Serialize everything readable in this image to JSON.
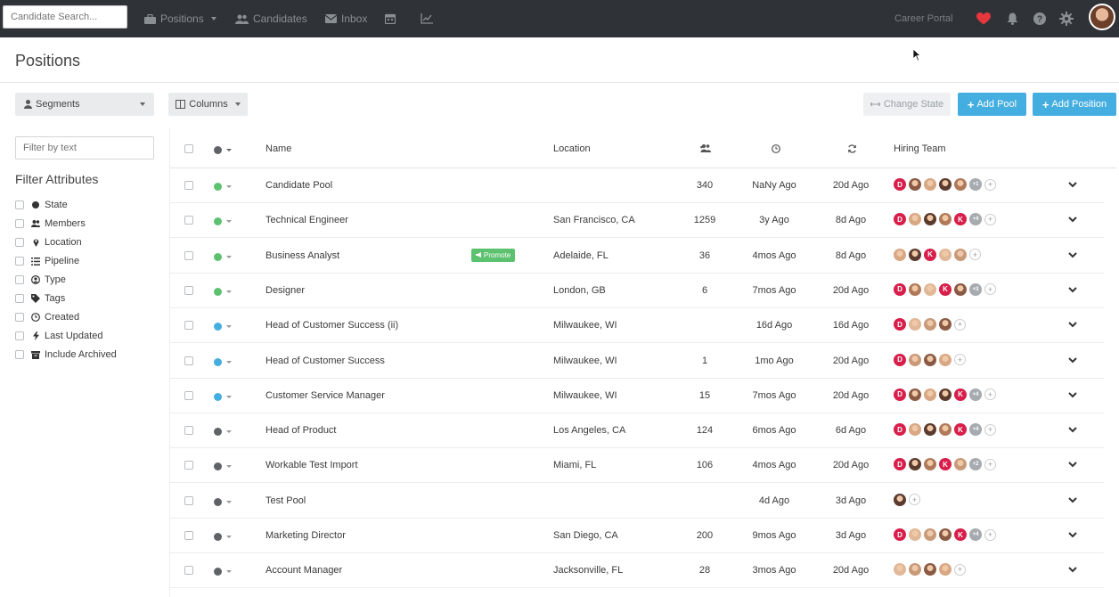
{
  "topbar": {
    "search_placeholder": "Candidate Search...",
    "nav": [
      {
        "label": "Positions",
        "icon": "briefcase-icon"
      },
      {
        "label": "Candidates",
        "icon": "users-icon"
      },
      {
        "label": "Inbox",
        "icon": "envelope-icon"
      },
      {
        "label": "",
        "icon": "calendar-icon"
      },
      {
        "label": "",
        "icon": "chart-icon"
      }
    ],
    "career_portal": "Career Portal"
  },
  "page": {
    "title": "Positions"
  },
  "toolbar": {
    "segments": "Segments",
    "columns": "Columns",
    "change_state": "Change State",
    "add_pool": "Add Pool",
    "add_position": "Add Position"
  },
  "sidebar": {
    "filter_placeholder": "Filter by text",
    "filter_title": "Filter Attributes",
    "attributes": [
      {
        "label": "State",
        "icon": "circle-icon"
      },
      {
        "label": "Members",
        "icon": "users-icon"
      },
      {
        "label": "Location",
        "icon": "map-pin-icon"
      },
      {
        "label": "Pipeline",
        "icon": "list-icon"
      },
      {
        "label": "Type",
        "icon": "user-circle-icon"
      },
      {
        "label": "Tags",
        "icon": "tag-icon"
      },
      {
        "label": "Created",
        "icon": "clock-icon"
      },
      {
        "label": "Last Updated",
        "icon": "bolt-icon"
      },
      {
        "label": "Include Archived",
        "icon": "archive-icon"
      }
    ]
  },
  "table": {
    "columns": {
      "name": "Name",
      "location": "Location",
      "hiring_team": "Hiring Team"
    },
    "promote_label": "Promote",
    "state_colors": {
      "green": "#5cc26f",
      "blue": "#45aee0",
      "gray": "#5f6367"
    },
    "rows": [
      {
        "name": "Candidate Pool",
        "location": "",
        "members": "340",
        "created": "NaNy Ago",
        "updated": "20d Ago",
        "state": "green",
        "team": [
          "D",
          "a",
          "a",
          "a",
          "a",
          "+1"
        ]
      },
      {
        "name": "Technical Engineer",
        "location": "San Francisco, CA",
        "members": "1259",
        "created": "3y Ago",
        "updated": "8d Ago",
        "state": "green",
        "team": [
          "D",
          "a",
          "a",
          "a",
          "K",
          "+4"
        ]
      },
      {
        "name": "Business Analyst",
        "location": "Adelaide, FL",
        "members": "36",
        "created": "4mos Ago",
        "updated": "8d Ago",
        "state": "green",
        "promote": true,
        "team": [
          "a",
          "a",
          "K",
          "a",
          "a"
        ]
      },
      {
        "name": "Designer",
        "location": "London, GB",
        "members": "6",
        "created": "7mos Ago",
        "updated": "20d Ago",
        "state": "green",
        "team": [
          "D",
          "a",
          "a",
          "K",
          "a",
          "+3"
        ]
      },
      {
        "name": "Head of Customer Success (ii)",
        "location": "Milwaukee, WI",
        "members": "",
        "created": "16d Ago",
        "updated": "16d Ago",
        "state": "blue",
        "team": [
          "D",
          "a",
          "a",
          "a"
        ]
      },
      {
        "name": "Head of Customer Success",
        "location": "Milwaukee, WI",
        "members": "1",
        "created": "1mo Ago",
        "updated": "20d Ago",
        "state": "blue",
        "team": [
          "D",
          "a",
          "a",
          "a"
        ]
      },
      {
        "name": "Customer Service Manager",
        "location": "Milwaukee, WI",
        "members": "15",
        "created": "7mos Ago",
        "updated": "20d Ago",
        "state": "blue",
        "team": [
          "D",
          "a",
          "a",
          "a",
          "K",
          "+4"
        ]
      },
      {
        "name": "Head of Product",
        "location": "Los Angeles, CA",
        "members": "124",
        "created": "6mos Ago",
        "updated": "6d Ago",
        "state": "gray",
        "team": [
          "D",
          "a",
          "a",
          "a",
          "K",
          "+4"
        ]
      },
      {
        "name": "Workable Test Import",
        "location": "Miami, FL",
        "members": "106",
        "created": "4mos Ago",
        "updated": "20d Ago",
        "state": "gray",
        "team": [
          "D",
          "a",
          "a",
          "K",
          "a",
          "+2"
        ]
      },
      {
        "name": "Test Pool",
        "location": "",
        "members": "",
        "created": "4d Ago",
        "updated": "3d Ago",
        "state": "gray",
        "team": [
          "a"
        ]
      },
      {
        "name": "Marketing Director",
        "location": "San Diego, CA",
        "members": "200",
        "created": "9mos Ago",
        "updated": "3d Ago",
        "state": "gray",
        "team": [
          "D",
          "a",
          "a",
          "a",
          "K",
          "+4"
        ]
      },
      {
        "name": "Account Manager",
        "location": "Jacksonville, FL",
        "members": "28",
        "created": "3mos Ago",
        "updated": "20d Ago",
        "state": "gray",
        "team": [
          "a",
          "a",
          "a",
          "a"
        ]
      }
    ]
  }
}
